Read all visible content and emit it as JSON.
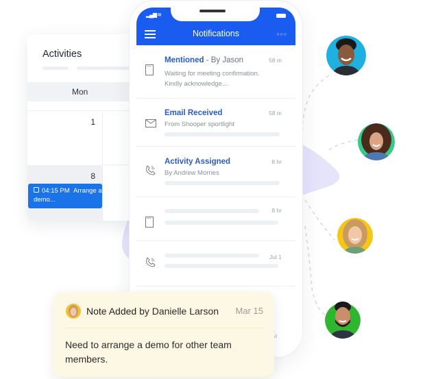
{
  "activities": {
    "title": "Activities",
    "day_header": "Mon",
    "dates": [
      "1",
      "8"
    ],
    "event": {
      "time": "04:15 PM",
      "text": "Arrange a demo...",
      "color": "#1a73e8"
    }
  },
  "phone": {
    "header": {
      "title": "Notifications",
      "menu_icon": "hamburger-icon",
      "more_icon": "more-dots-icon",
      "color": "#1a5cf0"
    },
    "notifications": [
      {
        "icon": "note-icon",
        "title": "Mentioned",
        "by": "- By Jason",
        "time": "58 m",
        "lines": [
          "Waiting for meeting confirmation.",
          "Kindly acknowledge..."
        ]
      },
      {
        "icon": "mail-icon",
        "title": "Email Received",
        "by": "",
        "time": "58 m",
        "lines": [
          "From Shooper sportlight"
        ]
      },
      {
        "icon": "phone-icon",
        "title": "Activity Assigned",
        "by": "",
        "time": "8 hr",
        "lines": [
          "By Andrew Morries"
        ]
      },
      {
        "icon": "note-icon",
        "title": "",
        "by": "",
        "time": "8 hr",
        "lines": []
      },
      {
        "icon": "phone-icon",
        "title": "",
        "by": "",
        "time": "Jul 1",
        "lines": []
      }
    ],
    "bottom_nav_partial": "ail"
  },
  "note_card": {
    "title": "Note Added",
    "by": "by Danielle Larson",
    "date": "Mar 15",
    "body": "Need to arrange a demo for other team members."
  },
  "avatars": [
    {
      "name": "avatar-man-smiling",
      "bg": "#1fb0e0"
    },
    {
      "name": "avatar-woman-curly",
      "bg": "#35c98a"
    },
    {
      "name": "avatar-woman-blonde",
      "bg": "#f5c518"
    },
    {
      "name": "avatar-man-beard",
      "bg": "#2fb52f"
    }
  ]
}
